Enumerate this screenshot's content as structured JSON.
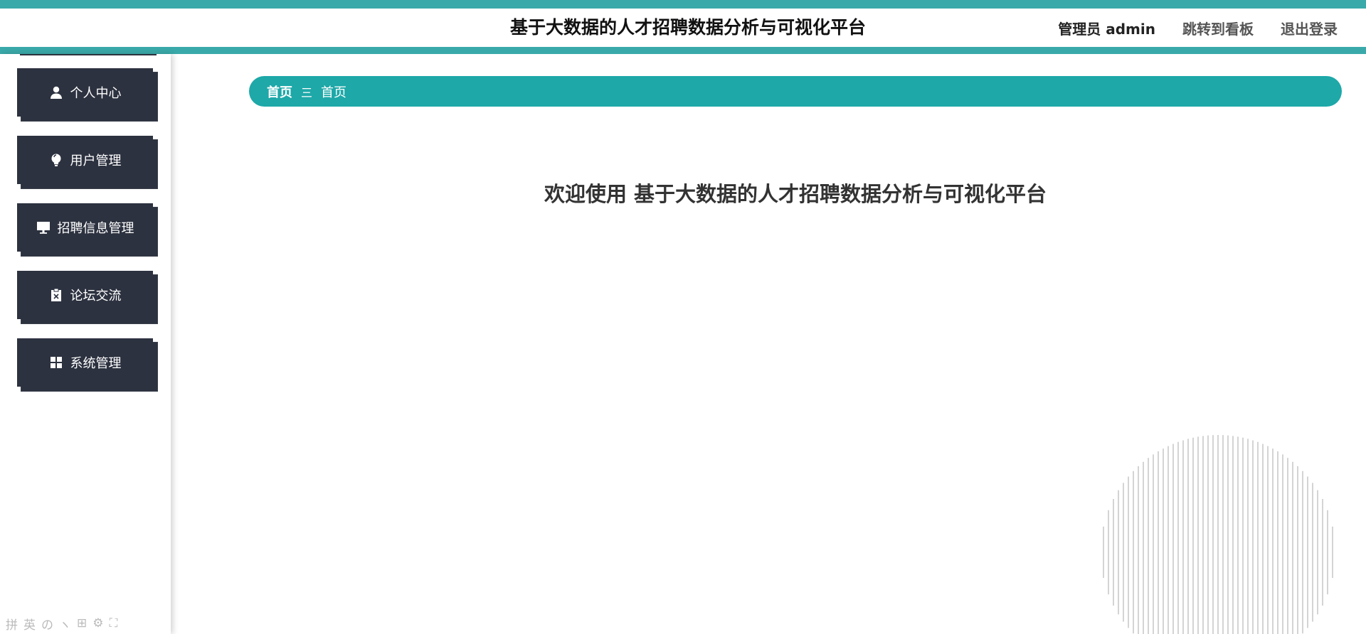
{
  "header": {
    "title": "基于大数据的人才招聘数据分析与可视化平台",
    "admin_label": "管理员 admin",
    "dashboard_link": "跳转到看板",
    "logout_link": "退出登录"
  },
  "sidebar": {
    "items": [
      {
        "label": "个人中心",
        "icon": "user-icon"
      },
      {
        "label": "用户管理",
        "icon": "lightbulb-icon"
      },
      {
        "label": "招聘信息管理",
        "icon": "monitor-icon"
      },
      {
        "label": "论坛交流",
        "icon": "clipboard-x-icon"
      },
      {
        "label": "系统管理",
        "icon": "grid-icon"
      }
    ]
  },
  "breadcrumb": {
    "home": "首页",
    "separator": "三",
    "current": "首页"
  },
  "main": {
    "welcome": "欢迎使用 基于大数据的人才招聘数据分析与可视化平台"
  },
  "ime": {
    "glyphs": [
      "拼",
      "英",
      "の",
      "ヽ",
      "⊞",
      "⚙",
      "⛶"
    ]
  },
  "colors": {
    "accent": "#1ea8a8",
    "header_border": "#3aa9a9",
    "menu_bg": "#2d3240"
  }
}
